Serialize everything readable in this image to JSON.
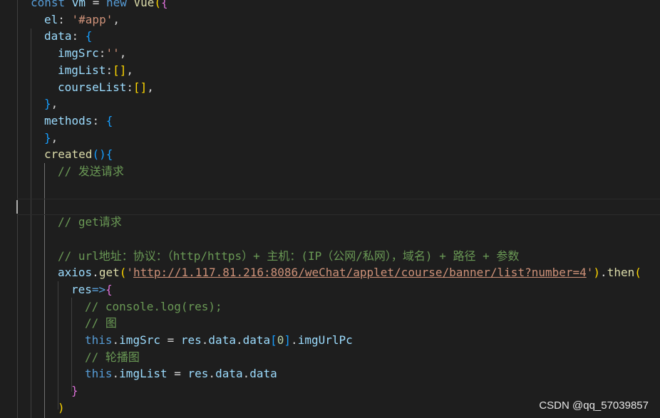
{
  "code": {
    "lines": [
      [
        {
          "t": "const ",
          "c": "kw"
        },
        {
          "t": "vm",
          "c": "var"
        },
        {
          "t": " = ",
          "c": "punc"
        },
        {
          "t": "new ",
          "c": "kw"
        },
        {
          "t": "Vue",
          "c": "func"
        },
        {
          "t": "(",
          "c": "br1"
        },
        {
          "t": "{",
          "c": "br2"
        }
      ],
      [
        {
          "t": "el",
          "c": "prop"
        },
        {
          "t": ": ",
          "c": "punc"
        },
        {
          "t": "'#app'",
          "c": "str"
        },
        {
          "t": ",",
          "c": "punc"
        }
      ],
      [
        {
          "t": "data",
          "c": "prop"
        },
        {
          "t": ": ",
          "c": "punc"
        },
        {
          "t": "{",
          "c": "br3"
        }
      ],
      [
        {
          "t": "imgSrc",
          "c": "prop"
        },
        {
          "t": ":",
          "c": "punc"
        },
        {
          "t": "''",
          "c": "str"
        },
        {
          "t": ",",
          "c": "punc"
        }
      ],
      [
        {
          "t": "imgList",
          "c": "prop"
        },
        {
          "t": ":",
          "c": "punc"
        },
        {
          "t": "[]",
          "c": "br1"
        },
        {
          "t": ",",
          "c": "punc"
        }
      ],
      [
        {
          "t": "courseList",
          "c": "prop"
        },
        {
          "t": ":",
          "c": "punc"
        },
        {
          "t": "[]",
          "c": "br1"
        },
        {
          "t": ",",
          "c": "punc"
        }
      ],
      [
        {
          "t": "}",
          "c": "br3"
        },
        {
          "t": ",",
          "c": "punc"
        }
      ],
      [
        {
          "t": "methods",
          "c": "prop"
        },
        {
          "t": ": ",
          "c": "punc"
        },
        {
          "t": "{",
          "c": "br3"
        }
      ],
      [
        {
          "t": "}",
          "c": "br3"
        },
        {
          "t": ",",
          "c": "punc"
        }
      ],
      [
        {
          "t": "created",
          "c": "func"
        },
        {
          "t": "()",
          "c": "br3"
        },
        {
          "t": "{",
          "c": "br3"
        }
      ],
      [
        {
          "t": "// 发送请求",
          "c": "com"
        }
      ],
      [],
      [],
      [
        {
          "t": "// get请求",
          "c": "com"
        }
      ],
      [],
      [
        {
          "t": "// url地址：协议：（http/https）+ 主机：(IP（公网/私网），域名) + 路径 + 参数",
          "c": "com"
        }
      ],
      [
        {
          "t": "axios",
          "c": "var"
        },
        {
          "t": ".",
          "c": "punc"
        },
        {
          "t": "get",
          "c": "func"
        },
        {
          "t": "(",
          "c": "br1"
        },
        {
          "t": "'",
          "c": "str"
        },
        {
          "t": "http://1.117.81.216:8086/weChat/applet/course/banner/list?number=4",
          "c": "url"
        },
        {
          "t": "'",
          "c": "str"
        },
        {
          "t": ")",
          "c": "br1"
        },
        {
          "t": ".",
          "c": "punc"
        },
        {
          "t": "then",
          "c": "func"
        },
        {
          "t": "(",
          "c": "br1"
        }
      ],
      [
        {
          "t": "res",
          "c": "var"
        },
        {
          "t": "=>",
          "c": "kw"
        },
        {
          "t": "{",
          "c": "br2"
        }
      ],
      [
        {
          "t": "// console.log(res);",
          "c": "com"
        }
      ],
      [
        {
          "t": "// 图",
          "c": "com"
        }
      ],
      [
        {
          "t": "this",
          "c": "this"
        },
        {
          "t": ".",
          "c": "punc"
        },
        {
          "t": "imgSrc",
          "c": "prop"
        },
        {
          "t": " = ",
          "c": "punc"
        },
        {
          "t": "res",
          "c": "var"
        },
        {
          "t": ".",
          "c": "punc"
        },
        {
          "t": "data",
          "c": "prop"
        },
        {
          "t": ".",
          "c": "punc"
        },
        {
          "t": "data",
          "c": "prop"
        },
        {
          "t": "[",
          "c": "br3"
        },
        {
          "t": "0",
          "c": "num"
        },
        {
          "t": "]",
          "c": "br3"
        },
        {
          "t": ".",
          "c": "punc"
        },
        {
          "t": "imgUrlPc",
          "c": "prop"
        }
      ],
      [
        {
          "t": "// 轮播图",
          "c": "com"
        }
      ],
      [
        {
          "t": "this",
          "c": "this"
        },
        {
          "t": ".",
          "c": "punc"
        },
        {
          "t": "imgList",
          "c": "prop"
        },
        {
          "t": " = ",
          "c": "punc"
        },
        {
          "t": "res",
          "c": "var"
        },
        {
          "t": ".",
          "c": "punc"
        },
        {
          "t": "data",
          "c": "prop"
        },
        {
          "t": ".",
          "c": "punc"
        },
        {
          "t": "data",
          "c": "prop"
        }
      ],
      [
        {
          "t": "}",
          "c": "br2"
        }
      ],
      [
        {
          "t": ")",
          "c": "br1"
        }
      ]
    ]
  },
  "watermark": "CSDN @qq_57039857"
}
